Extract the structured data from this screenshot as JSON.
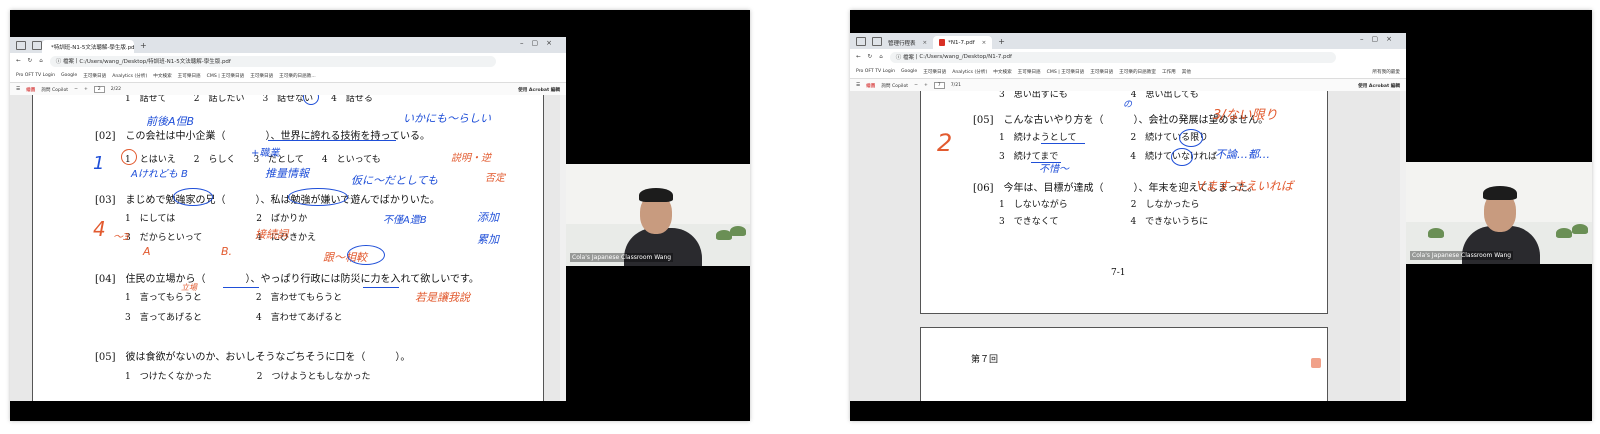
{
  "left": {
    "tab_title": "*特訓班-N1-5文法聴解-學生版.pdf",
    "address": "C:/Users/wang_/Desktop/特訓班-N1-5文法聴解-學生版.pdf",
    "address_label": "檔案",
    "bookmarks": [
      "Pro OFT TV Login",
      "Google",
      "王可樂日語",
      "Analytics (分析)",
      "中文検索",
      "王可樂日語",
      "CMS | 王可樂日語",
      "王可樂日語",
      "王可樂的日語教..."
    ],
    "pdf_toolbar": {
      "draw": "繪圖",
      "copilot": "詢問 Copilot",
      "page": "2",
      "total": "2/22",
      "acrobat": "使用 Acrobat 編輯"
    },
    "lines": [
      {
        "id": "l0",
        "text": "1　話せて　　　2　話したい　　3　話せない　　4　話せる"
      },
      {
        "id": "l1",
        "text": "[02]　この会社は中小企業（　　　　）、世界に誇れる技術を持っている。"
      },
      {
        "id": "l2",
        "text": "1　とはいえ　　2　らしく　　3　だとして　　4　といっても"
      },
      {
        "id": "l3",
        "text": "[03]　まじめで勉強家の兄（　　　）、私は勉強が嫌いで遊んでばかりいた。"
      },
      {
        "id": "l4",
        "text": "1　にしては　　　　　　　　　2　ばかりか"
      },
      {
        "id": "l5",
        "text": "3　だからといって　　　　　　4　にひきかえ"
      },
      {
        "id": "l6",
        "text": "[04]　住民の立場から（　　　　）、やっぱり行政には防災に力を入れて欲しいです。"
      },
      {
        "id": "l7",
        "text": "1　言ってもらうと　　　　　　2　言わせてもらうと"
      },
      {
        "id": "l8",
        "text": "3　言ってあげると　　　　　　4　言わせてあげると"
      },
      {
        "id": "l9",
        "text": "[05]　彼は食欲がないのか、おいしそうなごちそうに口を（　　　）。"
      },
      {
        "id": "l10",
        "text": "1　つけたくなかった　　　　　2　つけようともしなかった"
      }
    ],
    "annotations": [
      {
        "id": "a0",
        "text": "前後A但B",
        "color": "blue"
      },
      {
        "id": "a1",
        "text": "いかにも～らしい",
        "color": "blue"
      },
      {
        "id": "a2",
        "text": "1",
        "color": "blue"
      },
      {
        "id": "a3",
        "text": "Aけれども B",
        "color": "blue"
      },
      {
        "id": "a4",
        "text": "+職業",
        "color": "blue"
      },
      {
        "id": "a5",
        "text": "推量情報",
        "color": "blue"
      },
      {
        "id": "a6",
        "text": "仮に～だとしても",
        "color": "blue"
      },
      {
        "id": "a7",
        "text": "説明・逆",
        "color": "red"
      },
      {
        "id": "a8",
        "text": "否定",
        "color": "red"
      },
      {
        "id": "a9",
        "text": "不僅A還B",
        "color": "blue"
      },
      {
        "id": "a10",
        "text": "添加",
        "color": "blue"
      },
      {
        "id": "a11",
        "text": "累加",
        "color": "blue"
      },
      {
        "id": "a12",
        "text": "4",
        "color": "red"
      },
      {
        "id": "a13",
        "text": "～3",
        "color": "red"
      },
      {
        "id": "a14",
        "text": "A",
        "color": "red"
      },
      {
        "id": "a15",
        "text": "B.",
        "color": "red"
      },
      {
        "id": "a16",
        "text": "接続詞",
        "color": "red"
      },
      {
        "id": "a17",
        "text": "跟～相較",
        "color": "red"
      },
      {
        "id": "a18",
        "text": "立場",
        "color": "red"
      },
      {
        "id": "a19",
        "text": "若是讓我說",
        "color": "red"
      }
    ],
    "webcam_name": "Cola's Japanese Classroom Wang"
  },
  "right": {
    "tab_title_1": "管理行程表",
    "tab_title_2": "*N1-7.pdf",
    "address": "C:/Users/wang_/Desktop/N1-7.pdf",
    "address_label": "檔案",
    "bookmarks": [
      "Pro OFT TV Login",
      "Google",
      "王可樂日語",
      "Analytics (分析)",
      "中文検索",
      "王可樂日語",
      "CMS | 王可樂日語",
      "王可樂日語",
      "王可樂的日語教室",
      "工作用",
      "其他"
    ],
    "bookmark_right": "所有我的最愛",
    "pdf_toolbar": {
      "draw": "繪圖",
      "copilot": "詢問 Copilot",
      "page": "7",
      "total": "7/21",
      "acrobat": "使用 Acrobat 編輯"
    },
    "lines": [
      {
        "id": "r0",
        "text": "3　思い出すにも　　　　　　　4　思い出しても"
      },
      {
        "id": "r1",
        "text": "[05]　こんな古いやり方を（　　　）、会社の発展は望めません。"
      },
      {
        "id": "r2",
        "text": "1　続けようとして　　　　　　2　続けている限り"
      },
      {
        "id": "r3",
        "text": "3　続けてまで　　　　　　　　4　続けていなければ"
      },
      {
        "id": "r4",
        "text": "[06]　今年は、目標が達成（　　　）、年末を迎えてしまった。"
      },
      {
        "id": "r5",
        "text": "1　しないながら　　　　　　　2　しなかったら"
      },
      {
        "id": "r6",
        "text": "3　できなくて　　　　　　　　4　できないうちに"
      }
    ],
    "page_label": "7-1",
    "next_page_title": "第７回",
    "annotations": [
      {
        "id": "b0",
        "text": "3/ない限り",
        "color": "red"
      },
      {
        "id": "b1",
        "text": "2",
        "color": "red"
      },
      {
        "id": "b2",
        "text": "不惜～",
        "color": "blue"
      },
      {
        "id": "b3",
        "text": "不論…都…",
        "color": "blue"
      },
      {
        "id": "b4",
        "text": "Vます さえいれば",
        "color": "red"
      },
      {
        "id": "b5",
        "text": "の",
        "color": "blue"
      }
    ],
    "webcam_name": "Cola's Japanese Classroom Wang"
  }
}
